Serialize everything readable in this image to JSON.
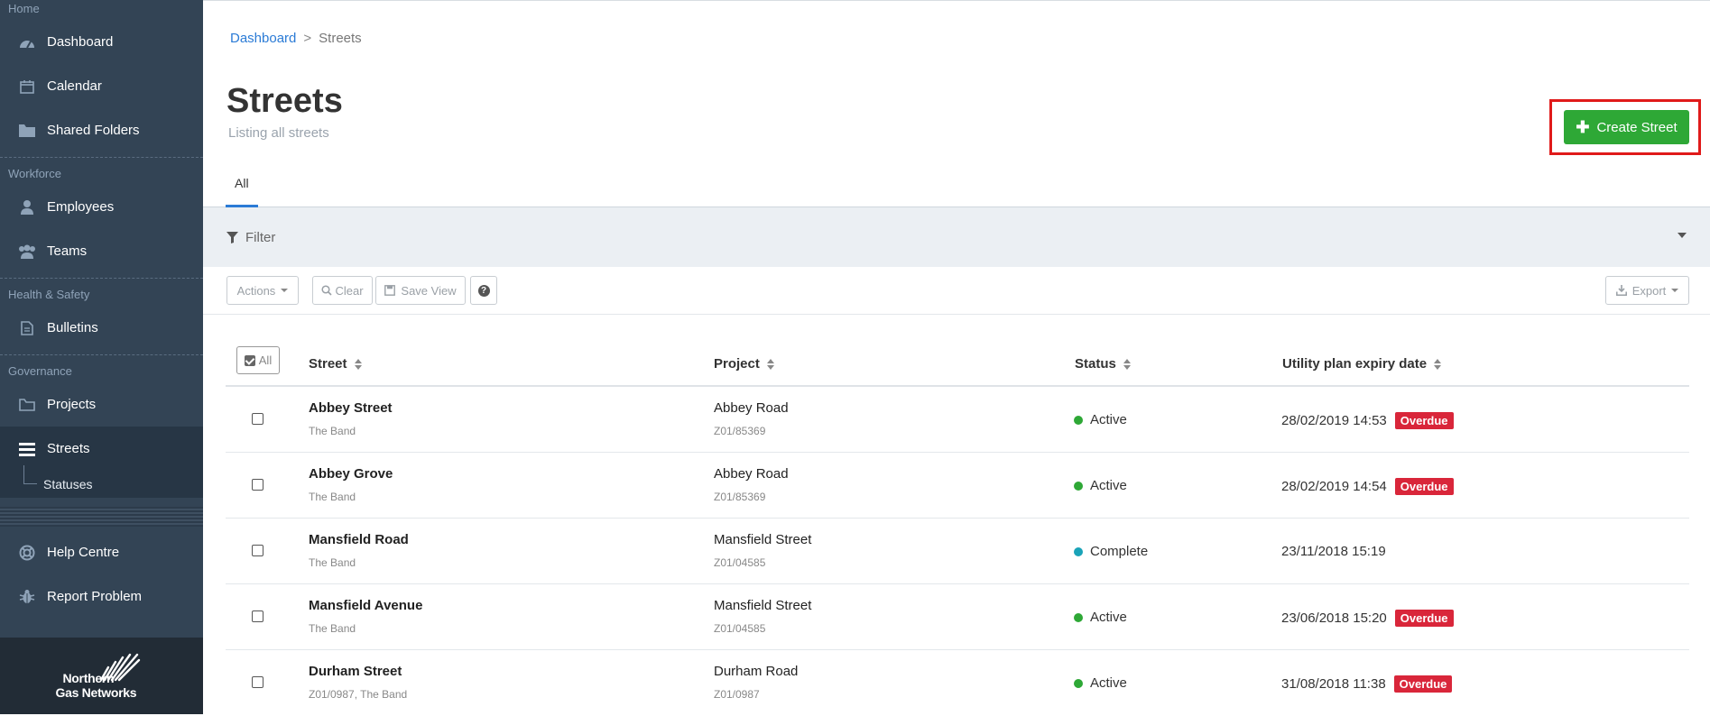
{
  "sidebar": {
    "sections": {
      "home": "Home",
      "workforce": "Workforce",
      "health_safety": "Health & Safety",
      "governance": "Governance"
    },
    "items": {
      "dashboard": "Dashboard",
      "calendar": "Calendar",
      "shared_folders": "Shared Folders",
      "employees": "Employees",
      "teams": "Teams",
      "bulletins": "Bulletins",
      "projects": "Projects",
      "streets": "Streets",
      "statuses": "Statuses",
      "help_centre": "Help Centre",
      "report_problem": "Report Problem"
    },
    "logo": {
      "line1": "Northern",
      "line2": "Gas Networks"
    }
  },
  "breadcrumb": {
    "root": "Dashboard",
    "sep": ">",
    "current": "Streets"
  },
  "page": {
    "title": "Streets",
    "subtitle": "Listing all streets"
  },
  "create_button": {
    "label": "Create Street"
  },
  "tabs": {
    "all": "All"
  },
  "filter": {
    "label": "Filter"
  },
  "toolbar": {
    "actions": "Actions",
    "clear": "Clear",
    "save_view": "Save View",
    "help": "?",
    "export": "Export"
  },
  "table": {
    "select_all": "All",
    "columns": {
      "street": "Street",
      "project": "Project",
      "status": "Status",
      "expiry": "Utility plan expiry date"
    },
    "rows": [
      {
        "street": "Abbey Street",
        "street_sub": "The Band",
        "project": "Abbey Road",
        "project_sub": "Z01/85369",
        "status": "Active",
        "expiry": "28/02/2019 14:53",
        "badge": "Overdue"
      },
      {
        "street": "Abbey Grove",
        "street_sub": "The Band",
        "project": "Abbey Road",
        "project_sub": "Z01/85369",
        "status": "Active",
        "expiry": "28/02/2019 14:54",
        "badge": "Overdue"
      },
      {
        "street": "Mansfield Road",
        "street_sub": "The Band",
        "project": "Mansfield Street",
        "project_sub": "Z01/04585",
        "status": "Complete",
        "expiry": "23/11/2018 15:19",
        "badge": ""
      },
      {
        "street": "Mansfield Avenue",
        "street_sub": "The Band",
        "project": "Mansfield Street",
        "project_sub": "Z01/04585",
        "status": "Active",
        "expiry": "23/06/2018 15:20",
        "badge": "Overdue"
      },
      {
        "street": "Durham Street",
        "street_sub": "Z01/0987, The Band",
        "project": "Durham Road",
        "project_sub": "Z01/0987",
        "status": "Active",
        "expiry": "31/08/2018 11:38",
        "badge": "Overdue"
      }
    ]
  },
  "colors": {
    "sidebar": "#334455",
    "accent_blue": "#2b7bd6",
    "create_green": "#2ea836",
    "highlight_red": "#e01a1a",
    "overdue_red": "#d9263a",
    "status_active": "#2ea836",
    "status_complete": "#1aa3b8"
  }
}
